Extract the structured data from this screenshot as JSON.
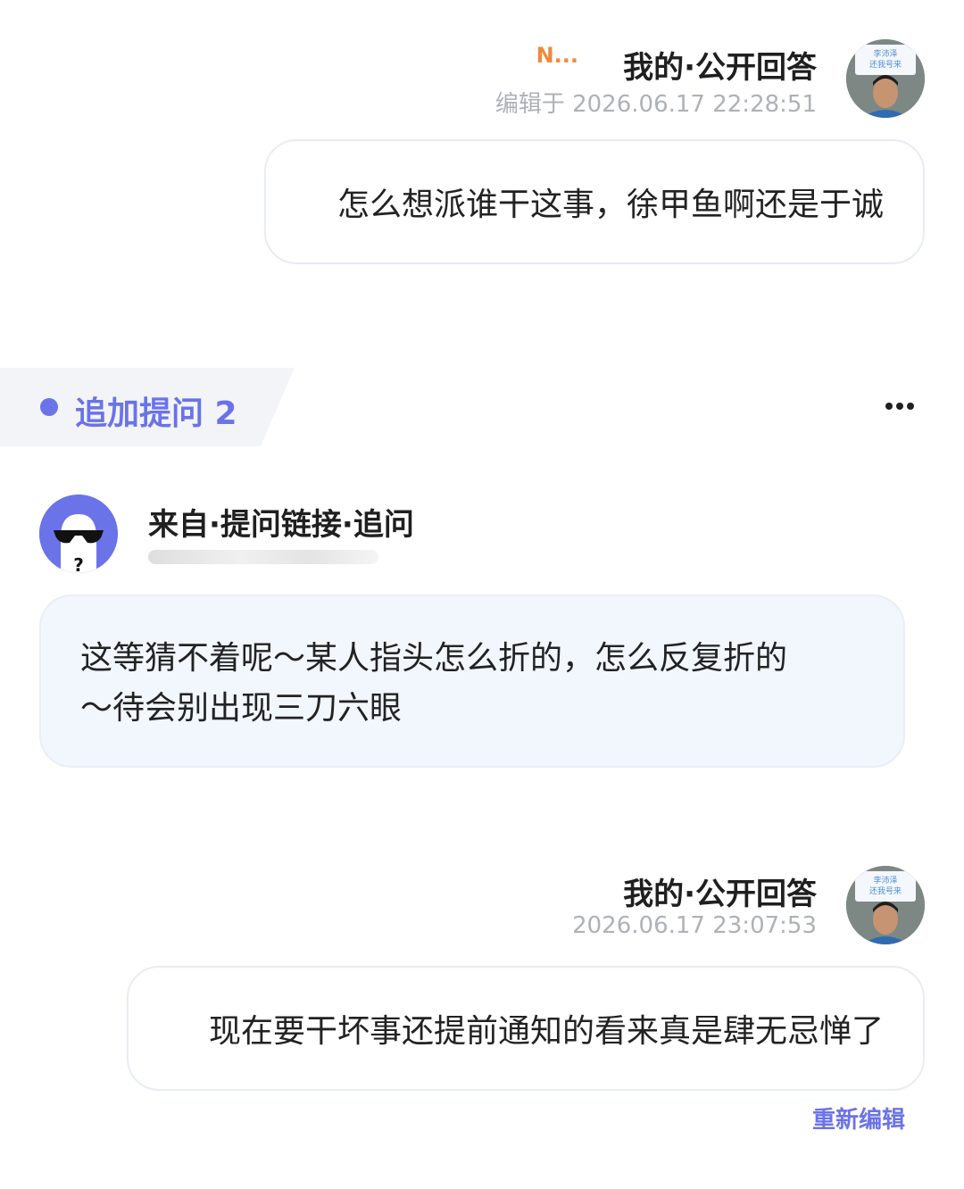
{
  "answer1": {
    "truncated_name": "N...",
    "title": "我的·公开回答",
    "timestamp": "编辑于 2026.06.17 22:28:51",
    "text": "怎么想派谁干这事，徐甲鱼啊还是于诚",
    "avatar_sign_text": "李沛泽 还我号来"
  },
  "followup": {
    "tag_label": "追加提问 2",
    "more_icon": "more-horizontal-icon",
    "asker_title": "来自·提问链接·追问",
    "asker_avatar_icon": "anonymous-sunglasses-icon",
    "question_lines": [
      "这等猜不着呢～某人指头怎么折的，怎么反复折的",
      "～待会别出现三刀六眼"
    ]
  },
  "answer2": {
    "title": "我的·公开回答",
    "timestamp": "2026.06.17 23:07:53",
    "text": "现在要干坏事还提前通知的看来真是肆无忌惮了",
    "avatar_sign_text": "李沛泽 还我号来",
    "reedit_label": "重新编辑"
  },
  "colors": {
    "accent": "#6b73e8",
    "orange_name": "#f08a3c",
    "timestamp": "#aeb1b8",
    "question_bg": "#f2f6fd"
  }
}
